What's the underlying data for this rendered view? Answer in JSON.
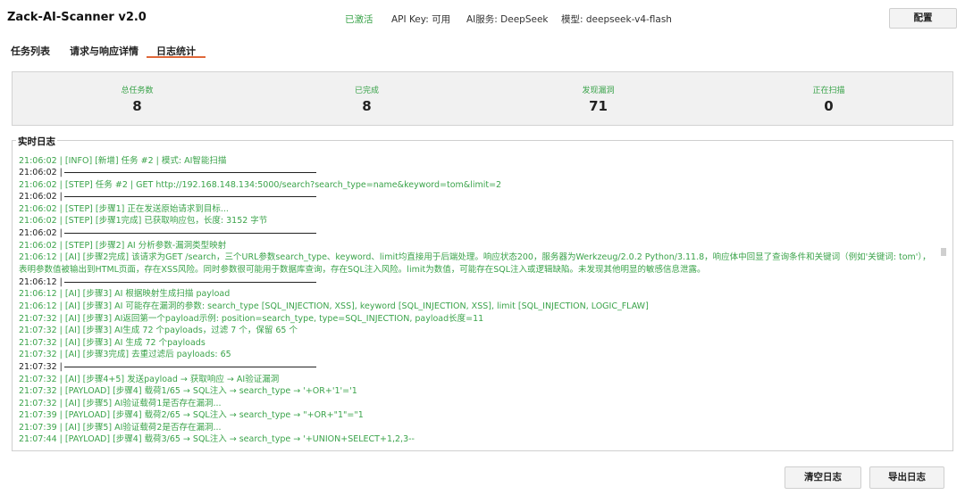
{
  "app": {
    "title": "Zack-AI-Scanner v2.0"
  },
  "status": {
    "activated": "已激活",
    "api_key": "API Key: 可用",
    "ai_service": "AI服务: DeepSeek",
    "model": "模型: deepseek-v4-flash",
    "config_label": "配置"
  },
  "tabs": [
    {
      "label": "任务列表"
    },
    {
      "label": "请求与响应详情"
    },
    {
      "label": "日志统计",
      "active": true
    }
  ],
  "stats": [
    {
      "label": "总任务数",
      "value": "8"
    },
    {
      "label": "已完成",
      "value": "8"
    },
    {
      "label": "发现漏洞",
      "value": "71"
    },
    {
      "label": "正在扫描",
      "value": "0"
    }
  ],
  "log": {
    "title": "实时日志",
    "lines": [
      "21:06:02 | [INFO] [新增] 任务 #2 | 模式: AI智能扫描",
      "21:06:02 |",
      "21:06:02 | [STEP] 任务 #2 | GET http://192.168.148.134:5000/search?search_type=name&keyword=tom&limit=2",
      "21:06:02 |",
      "21:06:02 | [STEP] [步骤1] 正在发送原始请求到目标...",
      "21:06:02 | [STEP] [步骤1完成] 已获取响应包，长度: 3152 字节",
      "21:06:02 |",
      "21:06:02 | [STEP] [步骤2] AI 分析参数-漏洞类型映射",
      "21:06:12 | [AI] [步骤2完成] 该请求为GET /search，三个URL参数search_type、keyword、limit均直接用于后端处理。响应状态200，服务器为Werkzeug/2.0.2 Python/3.11.8，响应体中回显了查询条件和关键词（例如'关键词: tom'），表明参数值被输出到HTML页面，存在XSS风险。同时参数很可能用于数据库查询，存在SQL注入风险。limit为数值，可能存在SQL注入或逻辑缺陷。未发现其他明显的敏感信息泄露。",
      "21:06:12 |",
      "21:06:12 | [AI] [步骤3] AI 根据映射生成扫描 payload",
      "21:06:12 | [AI] [步骤3] AI 可能存在漏洞的参数: search_type [SQL_INJECTION, XSS], keyword [SQL_INJECTION, XSS], limit [SQL_INJECTION, LOGIC_FLAW]",
      "21:07:32 | [AI] [步骤3] AI返回第一个payload示例: position=search_type, type=SQL_INJECTION, payload长度=11",
      "21:07:32 | [AI] [步骤3] AI生成 72 个payloads，过滤 7 个，保留 65 个",
      "21:07:32 | [AI] [步骤3] AI 生成 72 个payloads",
      "21:07:32 | [AI] [步骤3完成] 去重过滤后 payloads: 65",
      "21:07:32 |",
      "21:07:32 | [AI] [步骤4+5] 发送payload → 获取响应 → AI验证漏洞",
      "21:07:32 | [PAYLOAD] [步骤4] 载荷1/65 → SQL注入 → search_type → '+OR+'1'='1",
      "21:07:32 | [AI] [步骤5] AI验证载荷1是否存在漏洞...",
      "21:07:39 | [PAYLOAD] [步骤4] 载荷2/65 → SQL注入 → search_type → \"+OR+\"1\"=\"1",
      "21:07:39 | [AI] [步骤5] AI验证载荷2是否存在漏洞...",
      "21:07:44 | [PAYLOAD] [步骤4] 载荷3/65 → SQL注入 → search_type → '+UNION+SELECT+1,2,3--"
    ]
  },
  "actions": {
    "clear_label": "清空日志",
    "export_label": "导出日志"
  }
}
